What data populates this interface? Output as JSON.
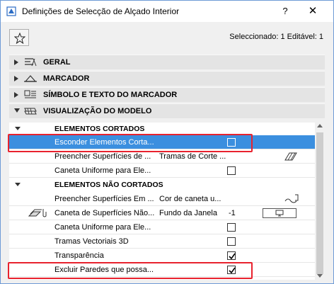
{
  "window": {
    "title": "Definições de Selecção de Alçado Interior",
    "help_label": "?",
    "close_label": "✕"
  },
  "selection_info": "Seleccionado: 1 Editável: 1",
  "panels": [
    {
      "label": "GERAL",
      "icon": "general-settings-icon",
      "expanded": false
    },
    {
      "label": "MARCADOR",
      "icon": "marker-icon",
      "expanded": false
    },
    {
      "label": "SÍMBOLO E TEXTO DO MARCADOR",
      "icon": "marker-symbol-icon",
      "expanded": false
    },
    {
      "label": "VISUALIZAÇÃO DO MODELO",
      "icon": "model-display-icon",
      "expanded": true
    }
  ],
  "sections": [
    {
      "title": "ELEMENTOS CORTADOS",
      "rows": [
        {
          "name": "Esconder Elementos Corta...",
          "type": "checkbox",
          "checked": false,
          "selected": true
        },
        {
          "name": "Preencher Superfícies de ...",
          "value": "Tramas de Corte ...",
          "type": "value",
          "tail_icon": "cut-fill-pattern-icon"
        },
        {
          "name": "Caneta Uniforme para Ele...",
          "type": "checkbox",
          "checked": false
        }
      ]
    },
    {
      "title": "ELEMENTOS NÃO CORTADOS",
      "rows": [
        {
          "name": "Preencher Superfícies Em ...",
          "value": "Cor de caneta u...",
          "type": "value",
          "tail_icon": "pen-color-icon"
        },
        {
          "name": "Caneta de Superfícies Não...",
          "value": "Fundo da Janela",
          "value2": "-1",
          "type": "pen",
          "row_icon": "surface-pen-icon",
          "tail_icon": "window-background-icon"
        },
        {
          "name": "Caneta Uniforme para Ele...",
          "type": "checkbox",
          "checked": false
        },
        {
          "name": "Tramas Vectoriais 3D",
          "type": "checkbox",
          "checked": false
        },
        {
          "name": "Transparência",
          "type": "checkbox",
          "checked": true
        },
        {
          "name": "Excluir Paredes que possa...",
          "type": "checkbox",
          "checked": true
        }
      ]
    }
  ],
  "colors": {
    "selection": "#3b8fdf",
    "highlight": "#e8222e",
    "panel_bg": "#e4e4e4"
  }
}
